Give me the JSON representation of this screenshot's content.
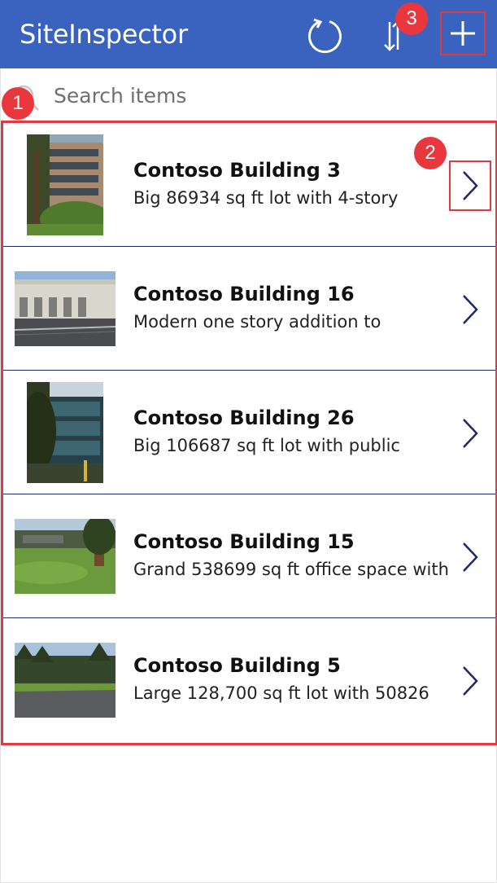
{
  "header": {
    "title": "SiteInspector",
    "background": "#3a62bf",
    "icons": [
      "refresh-icon",
      "sort-icon",
      "add-icon"
    ]
  },
  "search": {
    "placeholder": "Search items",
    "value": ""
  },
  "badges": [
    "1",
    "2",
    "3"
  ],
  "items": [
    {
      "title": "Contoso Building 3",
      "description": "Big 86934 sq ft lot with 4-story"
    },
    {
      "title": "Contoso Building 16",
      "description": "Modern one story addition to"
    },
    {
      "title": "Contoso Building 26",
      "description": "Big 106687 sq ft lot with public"
    },
    {
      "title": "Contoso Building 15",
      "description": "Grand 538699 sq ft office space with"
    },
    {
      "title": "Contoso Building 5",
      "description": "Large 128,700 sq ft lot with 50826"
    }
  ],
  "colors": {
    "accent": "#3a62bf",
    "highlight": "#e23a43",
    "divider": "#1f2d6d",
    "chevron": "#1b2a6b"
  }
}
